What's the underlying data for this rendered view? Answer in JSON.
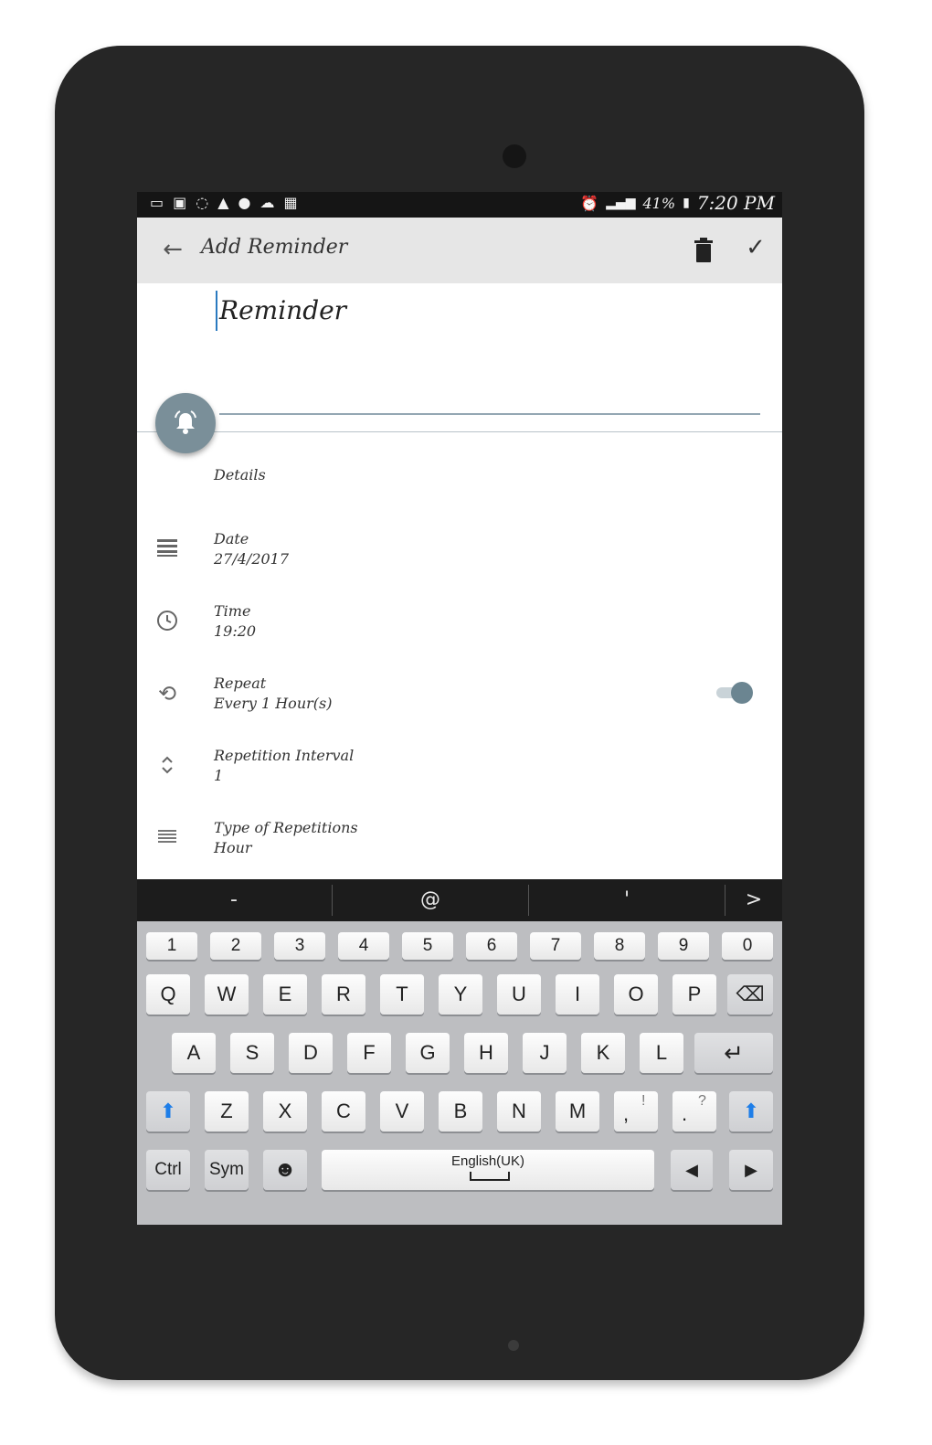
{
  "status": {
    "left_icons": [
      "keyboard-icon",
      "gallery-icon",
      "whatsapp-icon",
      "warning-icon",
      "dot-icon",
      "cloud-icon",
      "gift-icon"
    ],
    "battery": "41%",
    "time": "7:20 PM"
  },
  "appbar": {
    "title": "Add Reminder"
  },
  "reminder": {
    "title": "Reminder"
  },
  "details_label": "Details",
  "rows": [
    {
      "icon": "calendar-icon",
      "title": "Date",
      "value": "27/4/2017"
    },
    {
      "icon": "clock-icon",
      "title": "Time",
      "value": "19:20"
    },
    {
      "icon": "repeat-icon",
      "title": "Repeat",
      "value": "Every 1 Hour(s)",
      "toggle_on": true
    },
    {
      "icon": "unfold-icon",
      "title": "Repetition Interval",
      "value": "1"
    },
    {
      "icon": "list-icon",
      "title": "Type of Repetitions",
      "value": "Hour"
    }
  ],
  "suggestions": [
    "-",
    "@",
    "'",
    ">"
  ],
  "keyboard": {
    "numbers": [
      "1",
      "2",
      "3",
      "4",
      "5",
      "6",
      "7",
      "8",
      "9",
      "0"
    ],
    "row1": [
      "Q",
      "W",
      "E",
      "R",
      "T",
      "Y",
      "U",
      "I",
      "O",
      "P"
    ],
    "row2": [
      "A",
      "S",
      "D",
      "F",
      "G",
      "H",
      "J",
      "K",
      "L"
    ],
    "row3": [
      "Z",
      "X",
      "C",
      "V",
      "B",
      "N",
      "M"
    ],
    "comma": ",",
    "comma_alt": "!",
    "period": ".",
    "period_alt": "?",
    "ctrl": "Ctrl",
    "sym": "Sym",
    "space": "English(UK)",
    "backspace": "⌫",
    "enter": "↵",
    "shift": "⬆",
    "left": "◀",
    "right": "▶"
  },
  "colors": {
    "appbar": "#e6e6e6",
    "fab": "#7a8f99",
    "toggle_thumb": "#6b8591",
    "shift_blue": "#1e7ee8"
  }
}
